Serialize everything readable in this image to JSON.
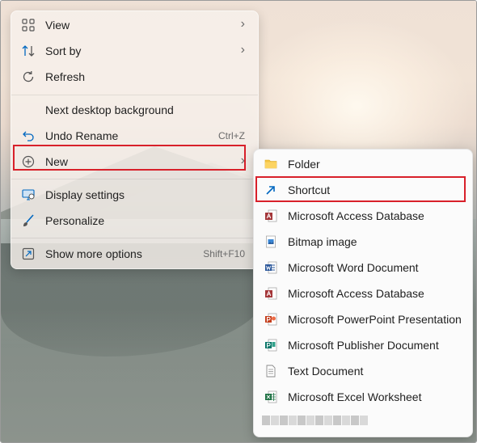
{
  "menu": {
    "items": [
      {
        "label": "View",
        "icon": "view-grid-icon",
        "submenu": true
      },
      {
        "label": "Sort by",
        "icon": "sort-icon",
        "submenu": true
      },
      {
        "label": "Refresh",
        "icon": "refresh-icon"
      },
      {
        "label": "Next desktop background"
      },
      {
        "label": "Undo Rename",
        "icon": "undo-icon",
        "shortcut": "Ctrl+Z"
      },
      {
        "label": "New",
        "icon": "new-plus-icon",
        "submenu": true
      },
      {
        "label": "Display settings",
        "icon": "display-icon"
      },
      {
        "label": "Personalize",
        "icon": "brush-icon"
      },
      {
        "label": "Show more options",
        "icon": "more-options-icon",
        "shortcut": "Shift+F10"
      }
    ],
    "arrow_glyph": "›"
  },
  "submenu": {
    "items": [
      {
        "label": "Folder",
        "icon": "folder-icon"
      },
      {
        "label": "Shortcut",
        "icon": "shortcut-icon"
      },
      {
        "label": "Microsoft Access Database",
        "icon": "access-icon"
      },
      {
        "label": "Bitmap image",
        "icon": "bitmap-icon"
      },
      {
        "label": "Microsoft Word Document",
        "icon": "word-icon"
      },
      {
        "label": "Microsoft Access Database",
        "icon": "access-icon"
      },
      {
        "label": "Microsoft PowerPoint Presentation",
        "icon": "powerpoint-icon"
      },
      {
        "label": "Microsoft Publisher Document",
        "icon": "publisher-icon"
      },
      {
        "label": "Text Document",
        "icon": "text-document-icon"
      },
      {
        "label": "Microsoft Excel Worksheet",
        "icon": "excel-icon"
      }
    ]
  },
  "colors": {
    "highlight": "#d8202a",
    "access": "#a4373a",
    "word": "#2b579a",
    "powerpoint": "#c43e1c",
    "publisher": "#077568",
    "excel": "#217346",
    "folder": "#f4c542",
    "shortcut": "#0067c0"
  }
}
